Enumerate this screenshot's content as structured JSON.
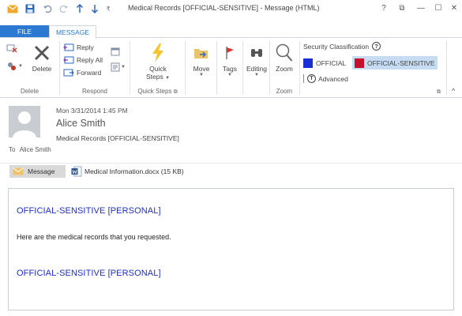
{
  "window": {
    "title": "Medical Records [OFFICIAL-SENSITIVE] - Message (HTML)",
    "help_glyph": "?",
    "restore_glyph": "⧉",
    "minimize_glyph": "—",
    "maximize_glyph": "☐",
    "close_glyph": "✕"
  },
  "quick_access": {
    "customize_glyph": "₹"
  },
  "tabs": {
    "file": "FILE",
    "message": "MESSAGE"
  },
  "ribbon": {
    "delete_group": {
      "label": "Delete",
      "delete_button": "Delete"
    },
    "respond_group": {
      "label": "Respond",
      "reply": "Reply",
      "reply_all": "Reply All",
      "forward": "Forward"
    },
    "quick_steps_group": {
      "label": "Quick Steps",
      "quick_steps_line1": "Quick",
      "quick_steps_line2": "Steps"
    },
    "move_button": "Move",
    "tags_button": "Tags",
    "editing_button": "Editing",
    "zoom_group": {
      "label": "Zoom",
      "zoom_button": "Zoom"
    },
    "security": {
      "heading": "Security Classification",
      "options": [
        "OFFICIAL",
        "OFFICIAL-SENSITIVE"
      ],
      "selected": "OFFICIAL-SENSITIVE",
      "advanced": "Advanced",
      "official_color": "#1a2ed8",
      "sensitive_color": "#c8102e",
      "selected_bg": "#c5dcf2"
    }
  },
  "message": {
    "date": "Mon 3/31/2014 1:45 PM",
    "from": "Alice Smith",
    "subject": "Medical Records [OFFICIAL-SENSITIVE]",
    "to_label": "To",
    "to": "Alice Smith"
  },
  "attachments": {
    "message_tab": "Message",
    "file": "Medical Information.docx (15 KB)"
  },
  "body": {
    "classification_top": "OFFICIAL-SENSITIVE [PERSONAL]",
    "text": "Here are the medical records that you requested.",
    "classification_bottom": "OFFICIAL-SENSITIVE [PERSONAL]"
  },
  "colors": {
    "accent": "#2b79d0",
    "classification_text": "#1f2ecb"
  }
}
